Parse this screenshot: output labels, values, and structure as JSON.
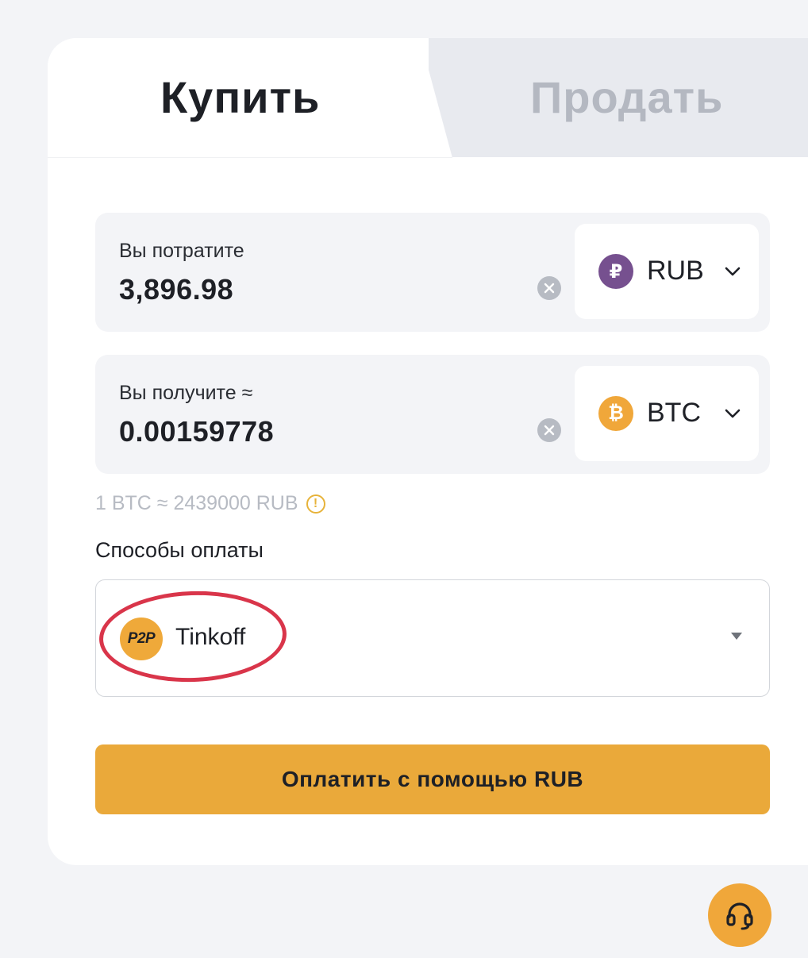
{
  "tabs": {
    "buy_label": "Купить",
    "sell_label": "Продать",
    "active": "buy"
  },
  "spend": {
    "label": "Вы потратите",
    "value": "3,896.98",
    "currency": "RUB",
    "currency_icon": "ruble-coin-icon",
    "currency_icon_color": "#76508f",
    "currency_symbol": "₽"
  },
  "receive": {
    "label": "Вы получите ≈",
    "value": "0.00159778",
    "currency": "BTC",
    "currency_icon": "bitcoin-coin-icon",
    "currency_icon_color": "#f0a73a",
    "currency_symbol": "₿"
  },
  "rate": {
    "text": "1 BTC ≈ 2439000 RUB",
    "icon": "warning-icon"
  },
  "payment": {
    "title": "Способы оплаты",
    "badge": "P2P",
    "selected": "Tinkoff"
  },
  "pay_button_label": "Оплатить с помощью RUB",
  "colors": {
    "accent": "#eaa93a",
    "highlight": "#d9354a"
  }
}
